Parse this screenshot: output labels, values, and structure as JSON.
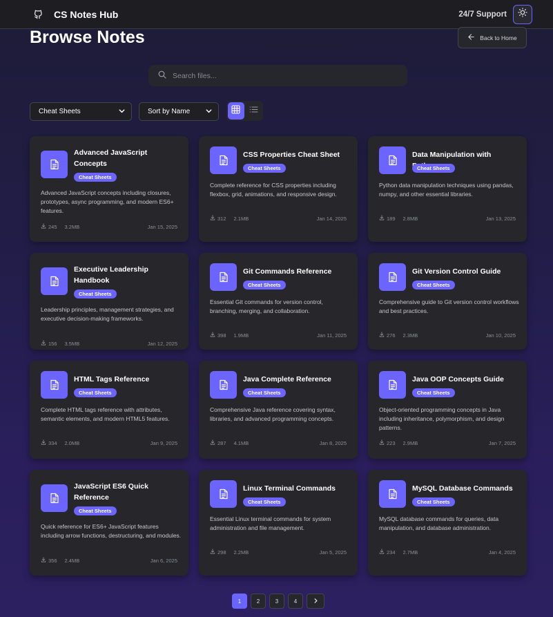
{
  "header": {
    "brand": "CS Notes Hub",
    "support_label": "24/7 Support",
    "theme_icon": "sun-icon"
  },
  "page": {
    "title": "Browse Notes",
    "back_label": "Back to Home"
  },
  "search": {
    "placeholder": "Search files..."
  },
  "filters": {
    "category": "Cheat Sheets",
    "sort": "Sort by Name",
    "view": "grid"
  },
  "colors": {
    "accent": "#6c64ff",
    "card_bg": "#26262b",
    "page_bg": "#221d48"
  },
  "notes": [
    {
      "title": "Advanced JavaScript Concepts",
      "badge": "Cheat Sheets",
      "description": "Advanced JavaScript concepts including closures, prototypes, async programming, and modern ES6+ features.",
      "downloads": "245",
      "size": "3.2MB",
      "date": "Jan 15, 2025"
    },
    {
      "title": "CSS Properties Cheat Sheet",
      "badge": "Cheat Sheets",
      "description": "Complete reference for CSS properties including flexbox, grid, animations, and responsive design.",
      "downloads": "312",
      "size": "2.1MB",
      "date": "Jan 14, 2025"
    },
    {
      "title": "Data Manipulation with Python",
      "badge": "Cheat Sheets",
      "description": "Python data manipulation techniques using pandas, numpy, and other essential libraries.",
      "downloads": "189",
      "size": "2.8MB",
      "date": "Jan 13, 2025"
    },
    {
      "title": "Executive Leadership Handbook",
      "badge": "Cheat Sheets",
      "description": "Leadership principles, management strategies, and executive decision-making frameworks.",
      "downloads": "156",
      "size": "3.5MB",
      "date": "Jan 12, 2025"
    },
    {
      "title": "Git Commands Reference",
      "badge": "Cheat Sheets",
      "description": "Essential Git commands for version control, branching, merging, and collaboration.",
      "downloads": "398",
      "size": "1.9MB",
      "date": "Jan 11, 2025"
    },
    {
      "title": "Git Version Control Guide",
      "badge": "Cheat Sheets",
      "description": "Comprehensive guide to Git version control workflows and best practices.",
      "downloads": "276",
      "size": "2.3MB",
      "date": "Jan 10, 2025"
    },
    {
      "title": "HTML Tags Reference",
      "badge": "Cheat Sheets",
      "description": "Complete HTML tags reference with attributes, semantic elements, and modern HTML5 features.",
      "downloads": "334",
      "size": "2.0MB",
      "date": "Jan 9, 2025"
    },
    {
      "title": "Java Complete Reference",
      "badge": "Cheat Sheets",
      "description": "Comprehensive Java reference covering syntax, libraries, and advanced programming concepts.",
      "downloads": "287",
      "size": "4.1MB",
      "date": "Jan 8, 2025"
    },
    {
      "title": "Java OOP Concepts Guide",
      "badge": "Cheat Sheets",
      "description": "Object-oriented programming concepts in Java including inheritance, polymorphism, and design patterns.",
      "downloads": "223",
      "size": "2.9MB",
      "date": "Jan 7, 2025"
    },
    {
      "title": "JavaScript ES6 Quick Reference",
      "badge": "Cheat Sheets",
      "description": "Quick reference for ES6+ JavaScript features including arrow functions, destructuring, and modules.",
      "downloads": "356",
      "size": "2.4MB",
      "date": "Jan 6, 2025"
    },
    {
      "title": "Linux Terminal Commands",
      "badge": "Cheat Sheets",
      "description": "Essential Linux terminal commands for system administration and file management.",
      "downloads": "298",
      "size": "2.2MB",
      "date": "Jan 5, 2025"
    },
    {
      "title": "MySQL Database Commands",
      "badge": "Cheat Sheets",
      "description": "MySQL database commands for queries, data manipulation, and database administration.",
      "downloads": "234",
      "size": "2.7MB",
      "date": "Jan 4, 2025"
    }
  ],
  "pagination": {
    "pages": [
      "1",
      "2",
      "3",
      "4"
    ],
    "current": "1",
    "next_icon": "chevron-right-icon"
  }
}
